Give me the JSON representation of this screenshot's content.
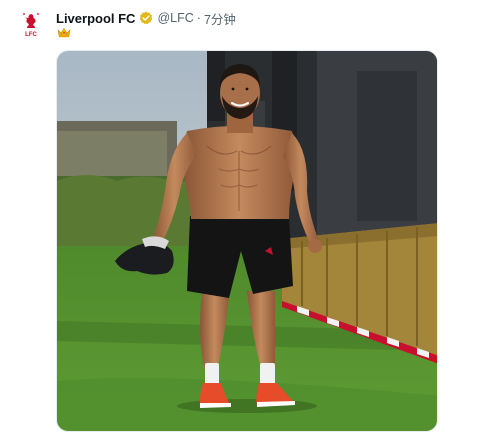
{
  "tweet": {
    "display_name": "Liverpool FC",
    "handle": "@LFC",
    "separator": "·",
    "time": "7分钟",
    "avatar_icon": "liverbird-crest-icon",
    "verified_icon": "gold-verified-badge-icon",
    "text_icon": "crown-emoji-icon",
    "colors": {
      "crest_red": "#c8102e",
      "verified_gold": "#e2b719",
      "name": "#0f1419",
      "muted": "#536471"
    }
  },
  "media": {
    "type": "photo",
    "description_icon": "player-training-photo"
  }
}
